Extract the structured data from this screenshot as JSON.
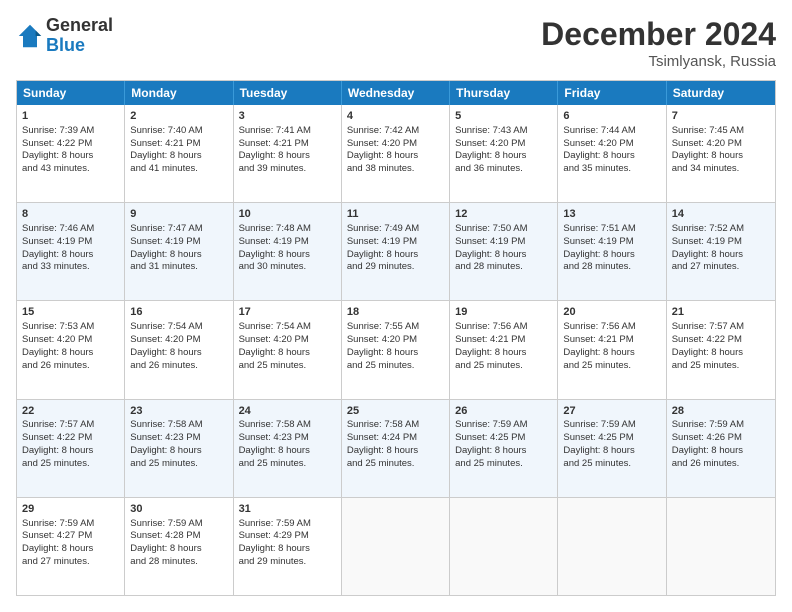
{
  "header": {
    "logo_line1": "General",
    "logo_line2": "Blue",
    "month_title": "December 2024",
    "location": "Tsimlyansk, Russia"
  },
  "weekdays": [
    "Sunday",
    "Monday",
    "Tuesday",
    "Wednesday",
    "Thursday",
    "Friday",
    "Saturday"
  ],
  "rows": [
    [
      {
        "day": "1",
        "lines": [
          "Sunrise: 7:39 AM",
          "Sunset: 4:22 PM",
          "Daylight: 8 hours",
          "and 43 minutes."
        ]
      },
      {
        "day": "2",
        "lines": [
          "Sunrise: 7:40 AM",
          "Sunset: 4:21 PM",
          "Daylight: 8 hours",
          "and 41 minutes."
        ]
      },
      {
        "day": "3",
        "lines": [
          "Sunrise: 7:41 AM",
          "Sunset: 4:21 PM",
          "Daylight: 8 hours",
          "and 39 minutes."
        ]
      },
      {
        "day": "4",
        "lines": [
          "Sunrise: 7:42 AM",
          "Sunset: 4:20 PM",
          "Daylight: 8 hours",
          "and 38 minutes."
        ]
      },
      {
        "day": "5",
        "lines": [
          "Sunrise: 7:43 AM",
          "Sunset: 4:20 PM",
          "Daylight: 8 hours",
          "and 36 minutes."
        ]
      },
      {
        "day": "6",
        "lines": [
          "Sunrise: 7:44 AM",
          "Sunset: 4:20 PM",
          "Daylight: 8 hours",
          "and 35 minutes."
        ]
      },
      {
        "day": "7",
        "lines": [
          "Sunrise: 7:45 AM",
          "Sunset: 4:20 PM",
          "Daylight: 8 hours",
          "and 34 minutes."
        ]
      }
    ],
    [
      {
        "day": "8",
        "lines": [
          "Sunrise: 7:46 AM",
          "Sunset: 4:19 PM",
          "Daylight: 8 hours",
          "and 33 minutes."
        ]
      },
      {
        "day": "9",
        "lines": [
          "Sunrise: 7:47 AM",
          "Sunset: 4:19 PM",
          "Daylight: 8 hours",
          "and 31 minutes."
        ]
      },
      {
        "day": "10",
        "lines": [
          "Sunrise: 7:48 AM",
          "Sunset: 4:19 PM",
          "Daylight: 8 hours",
          "and 30 minutes."
        ]
      },
      {
        "day": "11",
        "lines": [
          "Sunrise: 7:49 AM",
          "Sunset: 4:19 PM",
          "Daylight: 8 hours",
          "and 29 minutes."
        ]
      },
      {
        "day": "12",
        "lines": [
          "Sunrise: 7:50 AM",
          "Sunset: 4:19 PM",
          "Daylight: 8 hours",
          "and 28 minutes."
        ]
      },
      {
        "day": "13",
        "lines": [
          "Sunrise: 7:51 AM",
          "Sunset: 4:19 PM",
          "Daylight: 8 hours",
          "and 28 minutes."
        ]
      },
      {
        "day": "14",
        "lines": [
          "Sunrise: 7:52 AM",
          "Sunset: 4:19 PM",
          "Daylight: 8 hours",
          "and 27 minutes."
        ]
      }
    ],
    [
      {
        "day": "15",
        "lines": [
          "Sunrise: 7:53 AM",
          "Sunset: 4:20 PM",
          "Daylight: 8 hours",
          "and 26 minutes."
        ]
      },
      {
        "day": "16",
        "lines": [
          "Sunrise: 7:54 AM",
          "Sunset: 4:20 PM",
          "Daylight: 8 hours",
          "and 26 minutes."
        ]
      },
      {
        "day": "17",
        "lines": [
          "Sunrise: 7:54 AM",
          "Sunset: 4:20 PM",
          "Daylight: 8 hours",
          "and 25 minutes."
        ]
      },
      {
        "day": "18",
        "lines": [
          "Sunrise: 7:55 AM",
          "Sunset: 4:20 PM",
          "Daylight: 8 hours",
          "and 25 minutes."
        ]
      },
      {
        "day": "19",
        "lines": [
          "Sunrise: 7:56 AM",
          "Sunset: 4:21 PM",
          "Daylight: 8 hours",
          "and 25 minutes."
        ]
      },
      {
        "day": "20",
        "lines": [
          "Sunrise: 7:56 AM",
          "Sunset: 4:21 PM",
          "Daylight: 8 hours",
          "and 25 minutes."
        ]
      },
      {
        "day": "21",
        "lines": [
          "Sunrise: 7:57 AM",
          "Sunset: 4:22 PM",
          "Daylight: 8 hours",
          "and 25 minutes."
        ]
      }
    ],
    [
      {
        "day": "22",
        "lines": [
          "Sunrise: 7:57 AM",
          "Sunset: 4:22 PM",
          "Daylight: 8 hours",
          "and 25 minutes."
        ]
      },
      {
        "day": "23",
        "lines": [
          "Sunrise: 7:58 AM",
          "Sunset: 4:23 PM",
          "Daylight: 8 hours",
          "and 25 minutes."
        ]
      },
      {
        "day": "24",
        "lines": [
          "Sunrise: 7:58 AM",
          "Sunset: 4:23 PM",
          "Daylight: 8 hours",
          "and 25 minutes."
        ]
      },
      {
        "day": "25",
        "lines": [
          "Sunrise: 7:58 AM",
          "Sunset: 4:24 PM",
          "Daylight: 8 hours",
          "and 25 minutes."
        ]
      },
      {
        "day": "26",
        "lines": [
          "Sunrise: 7:59 AM",
          "Sunset: 4:25 PM",
          "Daylight: 8 hours",
          "and 25 minutes."
        ]
      },
      {
        "day": "27",
        "lines": [
          "Sunrise: 7:59 AM",
          "Sunset: 4:25 PM",
          "Daylight: 8 hours",
          "and 25 minutes."
        ]
      },
      {
        "day": "28",
        "lines": [
          "Sunrise: 7:59 AM",
          "Sunset: 4:26 PM",
          "Daylight: 8 hours",
          "and 26 minutes."
        ]
      }
    ],
    [
      {
        "day": "29",
        "lines": [
          "Sunrise: 7:59 AM",
          "Sunset: 4:27 PM",
          "Daylight: 8 hours",
          "and 27 minutes."
        ]
      },
      {
        "day": "30",
        "lines": [
          "Sunrise: 7:59 AM",
          "Sunset: 4:28 PM",
          "Daylight: 8 hours",
          "and 28 minutes."
        ]
      },
      {
        "day": "31",
        "lines": [
          "Sunrise: 7:59 AM",
          "Sunset: 4:29 PM",
          "Daylight: 8 hours",
          "and 29 minutes."
        ]
      },
      {
        "day": "",
        "lines": []
      },
      {
        "day": "",
        "lines": []
      },
      {
        "day": "",
        "lines": []
      },
      {
        "day": "",
        "lines": []
      }
    ]
  ]
}
